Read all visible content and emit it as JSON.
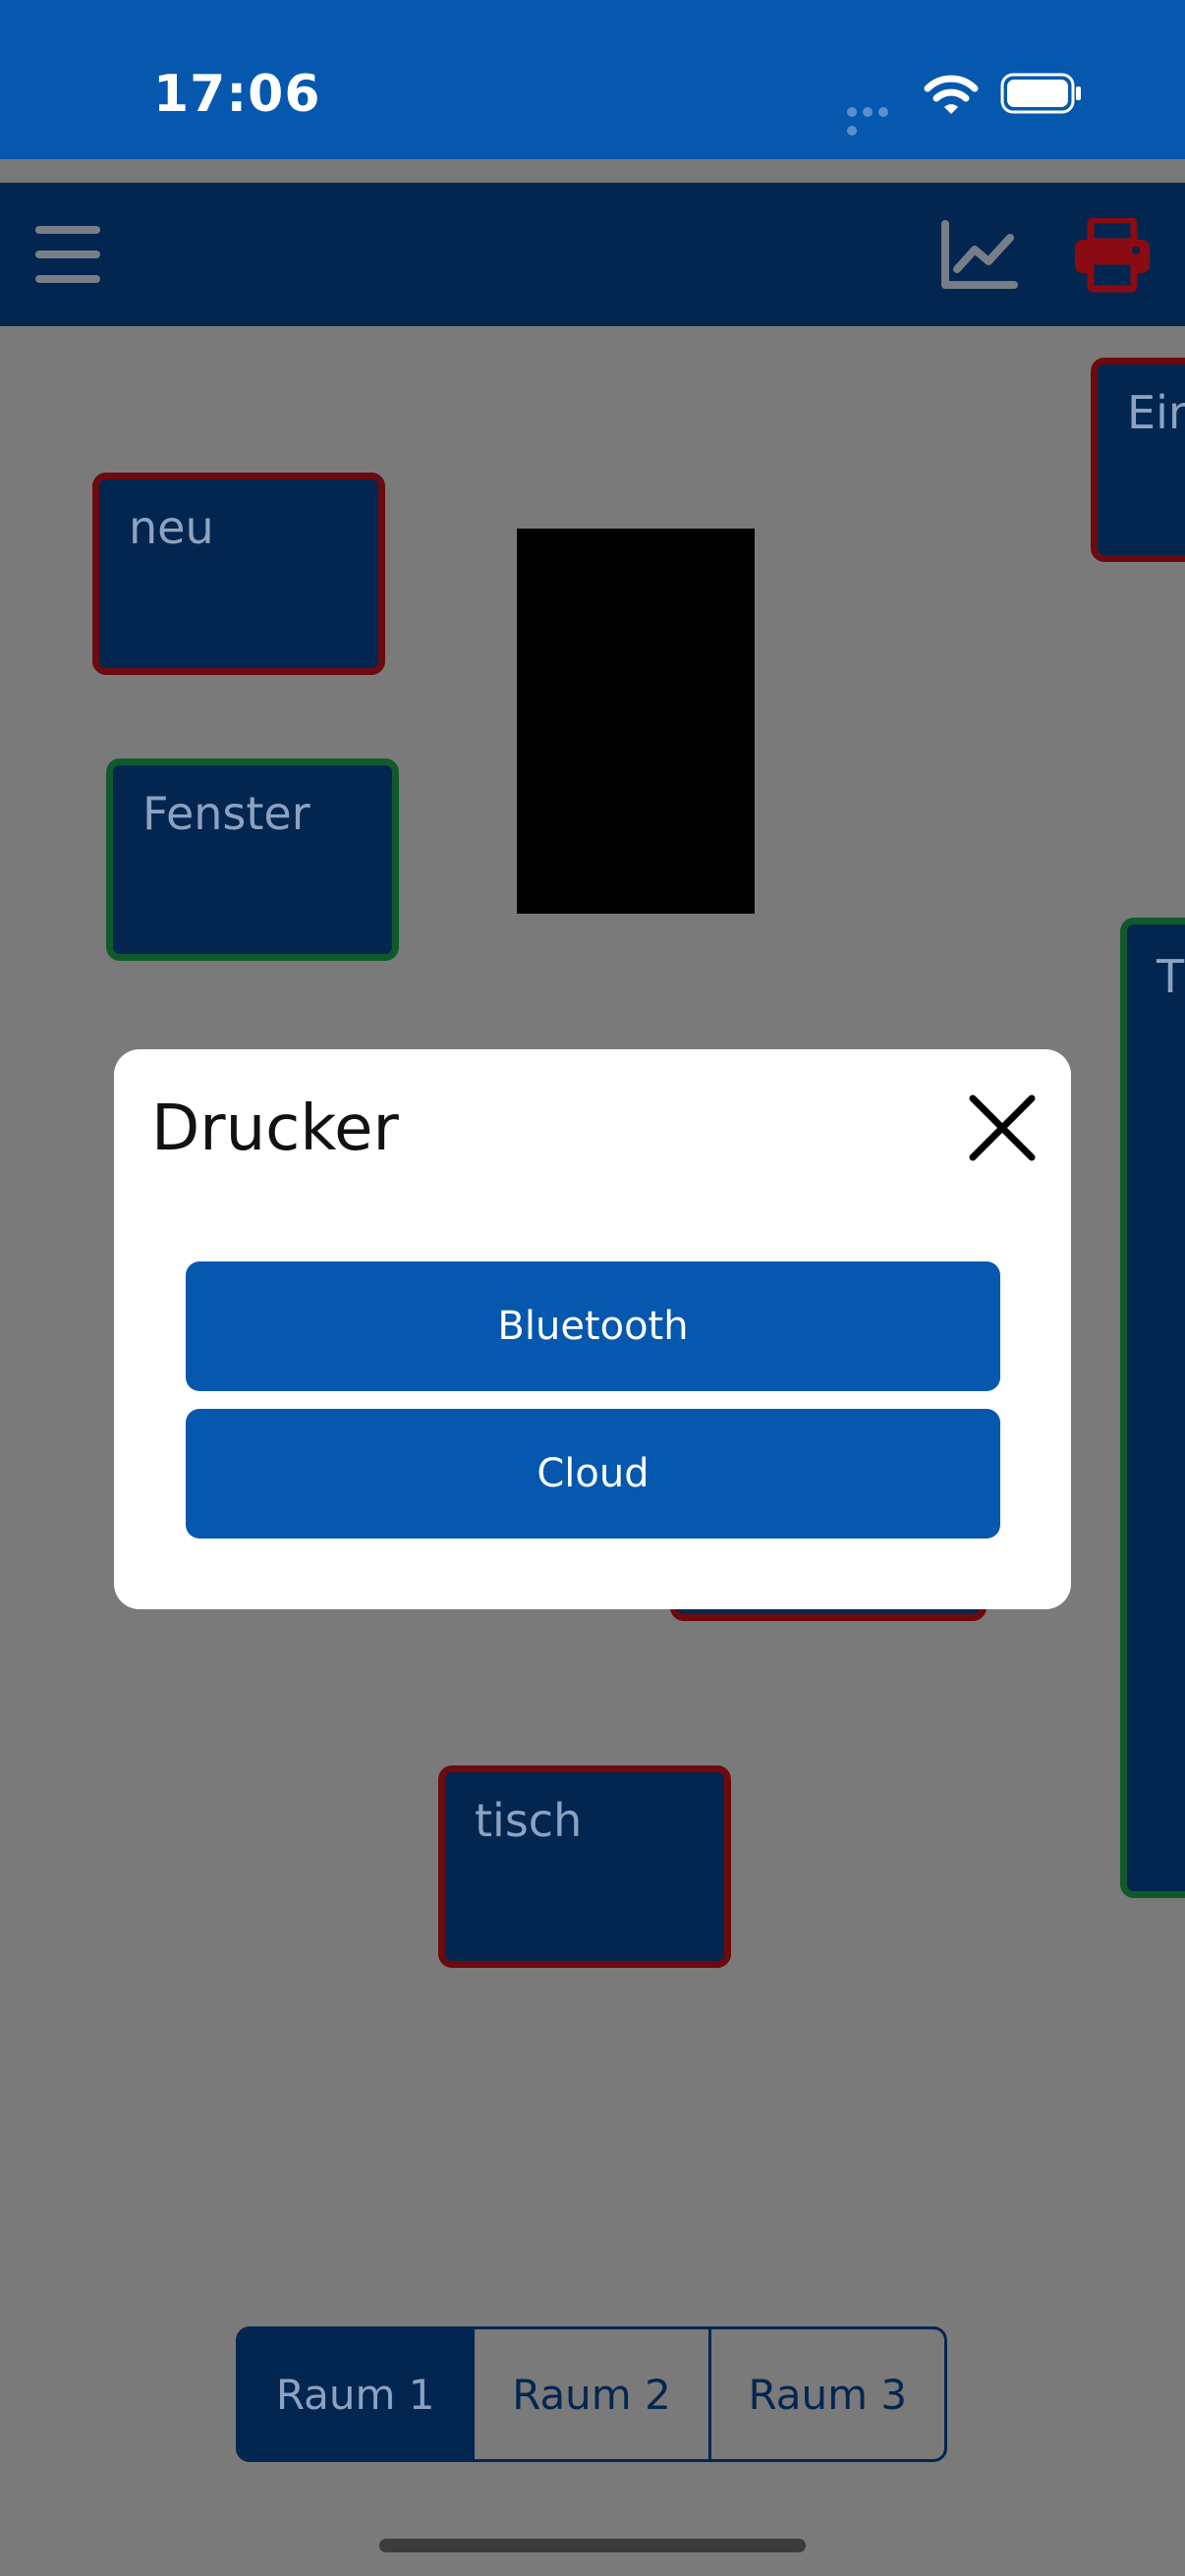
{
  "status_bar": {
    "time": "17:06"
  },
  "toolbar": {
    "menu_icon": "hamburger-menu-icon",
    "chart_icon": "line-chart-icon",
    "printer_icon": "printer-icon",
    "printer_color": "#8a0c12"
  },
  "tiles": [
    {
      "label": "neu",
      "status": "red"
    },
    {
      "label": "Fenster",
      "status": "green"
    },
    {
      "label": "Ein",
      "status": "red"
    },
    {
      "label": "T",
      "status": "green"
    },
    {
      "label": "tisch",
      "status": "red"
    },
    {
      "label": "",
      "status": "red"
    }
  ],
  "dialog": {
    "title": "Drucker",
    "close_icon": "close-icon",
    "options": [
      "Bluetooth",
      "Cloud"
    ]
  },
  "room_tabs": {
    "items": [
      "Raum 1",
      "Raum 2",
      "Raum 3"
    ],
    "selected": "Raum 1"
  },
  "colors": {
    "primary_blue": "#0558ad",
    "dark_navy": "#032650",
    "status_red": "#6b0a0f",
    "status_green": "#0f5a2b",
    "overlay_gray": "#7a7a7a"
  }
}
